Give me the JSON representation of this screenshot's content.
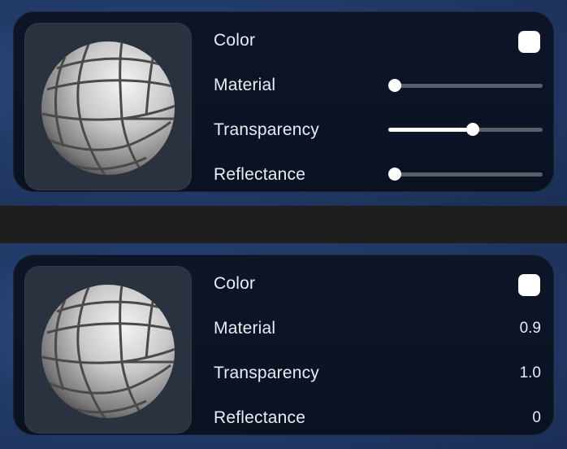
{
  "panel_top": {
    "rows": [
      {
        "label": "Color",
        "swatch_color": "#ffffff"
      },
      {
        "label": "Material",
        "slider_fraction": 0.0
      },
      {
        "label": "Transparency",
        "slider_fraction": 0.55
      },
      {
        "label": "Reflectance",
        "slider_fraction": 0.0
      }
    ]
  },
  "panel_bottom": {
    "rows": [
      {
        "label": "Color",
        "swatch_color": "#ffffff"
      },
      {
        "label": "Material",
        "value": "0.9"
      },
      {
        "label": "Transparency",
        "value": "1.0"
      },
      {
        "label": "Reflectance",
        "value": "0"
      }
    ]
  },
  "icons": {
    "preview": "material-sphere-icon"
  },
  "colors": {
    "panel_bg": "#0b1324",
    "band_bg": "#223c6a",
    "slider_track": "#5a5f68",
    "slider_active": "#ffffff"
  }
}
